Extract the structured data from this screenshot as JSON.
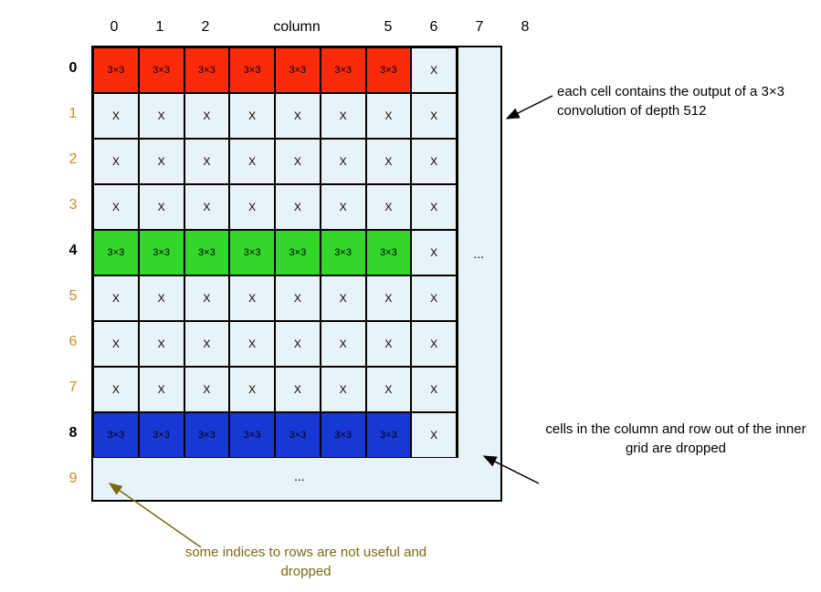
{
  "col_headers": [
    "0",
    "1",
    "2",
    "column",
    "5",
    "6",
    "7",
    "8"
  ],
  "col_header_wide_index": 3,
  "rows": [
    {
      "label": "0",
      "style": "bold",
      "type": "color",
      "color": "red",
      "lastX": true
    },
    {
      "label": "1",
      "style": "orange",
      "type": "x"
    },
    {
      "label": "2",
      "style": "orange",
      "type": "x"
    },
    {
      "label": "3",
      "style": "orange",
      "type": "x"
    },
    {
      "label": "4",
      "style": "bold",
      "type": "color",
      "color": "green",
      "lastX": true
    },
    {
      "label": "5",
      "style": "orange",
      "type": "x"
    },
    {
      "label": "6",
      "style": "orange",
      "type": "x"
    },
    {
      "label": "7",
      "style": "orange",
      "type": "x"
    },
    {
      "label": "8",
      "style": "bold",
      "type": "color",
      "color": "blue",
      "lastX": true
    },
    {
      "label": "9",
      "style": "orange",
      "type": "none"
    }
  ],
  "cell_color_text": "3×3",
  "cell_x_text": "X",
  "ellipsis": "...",
  "annotations": {
    "right1": "each cell contains the output of a 3×3 convolution of depth 512",
    "right2": "cells in the column and row out of the inner grid are dropped",
    "bottom": "some indices to rows are not useful and dropped"
  }
}
